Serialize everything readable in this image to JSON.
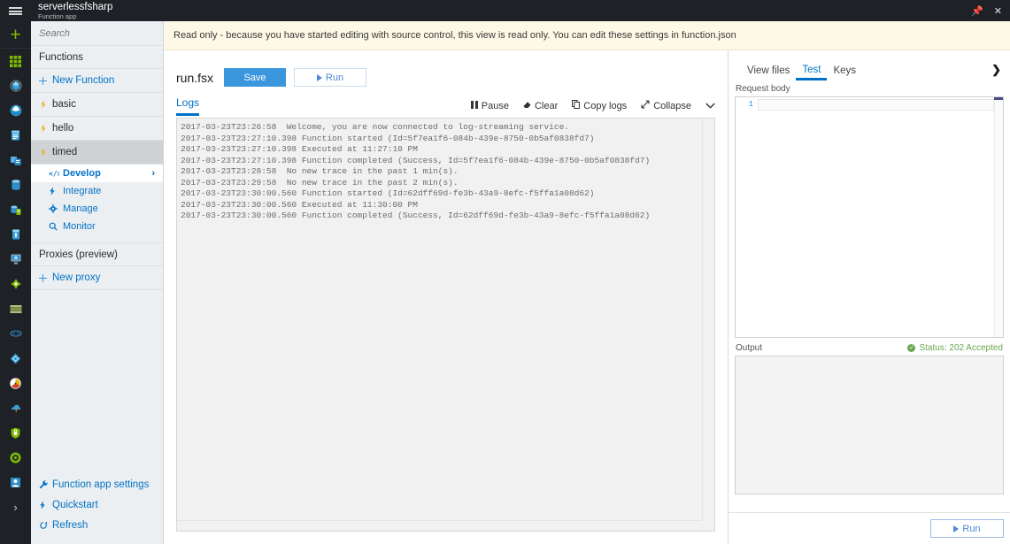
{
  "titlebar": {
    "app_name": "serverlessfsharp",
    "app_subtitle": "Function app",
    "pin_icon": "pin-icon",
    "close_icon": "close-icon"
  },
  "rail": {
    "hamburger": "hamburger-icon",
    "new_label": "+",
    "icons": [
      "dashboard-grid-icon",
      "all-resources-icon",
      "resource-groups-icon",
      "app-services-icon",
      "function-apps-icon",
      "sql-databases-icon",
      "azure-cosmos-db-icon",
      "virtual-machines-icon",
      "load-balancers-icon",
      "storage-accounts-icon",
      "virtual-networks-icon",
      "azure-active-directory-icon",
      "monitor-icon",
      "advisor-icon",
      "security-center-icon",
      "cost-management-icon",
      "help-support-icon"
    ],
    "more_chevron": "chevron-right-icon"
  },
  "banner": {
    "text": "Read only - because you have started editing with source control, this view is read only. You can edit these settings in function.json"
  },
  "sidebar": {
    "search": {
      "placeholder": "Search",
      "value": ""
    },
    "section_functions": "Functions",
    "new_function": "New Function",
    "functions": [
      {
        "label": "basic",
        "icon": "function-icon",
        "selected": false
      },
      {
        "label": "hello",
        "icon": "function-icon",
        "selected": false
      },
      {
        "label": "timed",
        "icon": "function-icon",
        "selected": true
      }
    ],
    "sub_items": [
      {
        "label": "Develop",
        "icon": "code-icon",
        "active": true
      },
      {
        "label": "Integrate",
        "icon": "bolt-icon",
        "active": false
      },
      {
        "label": "Manage",
        "icon": "gear-icon",
        "active": false
      },
      {
        "label": "Monitor",
        "icon": "search-icon",
        "active": false
      }
    ],
    "section_proxies": "Proxies (preview)",
    "new_proxy": "New proxy",
    "bottom_items": [
      {
        "label": "Function app settings",
        "icon": "wrench-icon"
      },
      {
        "label": "Quickstart",
        "icon": "bolt-icon"
      },
      {
        "label": "Refresh",
        "icon": "refresh-icon"
      }
    ]
  },
  "command_bar": {
    "file_name": "run.fsx",
    "save_label": "Save",
    "run_label": "Run"
  },
  "logs": {
    "tab_label": "Logs",
    "tools": [
      {
        "label": "Pause",
        "icon": "pause-icon"
      },
      {
        "label": "Clear",
        "icon": "eraser-icon"
      },
      {
        "label": "Copy logs",
        "icon": "copy-icon"
      },
      {
        "label": "Collapse",
        "icon": "collapse-icon"
      }
    ],
    "chevron": "chevron-down-icon",
    "lines": [
      "2017-03-23T23:26:58  Welcome, you are now connected to log-streaming service.",
      "2017-03-23T23:27:10.398 Function started (Id=5f7ea1f6-084b-439e-8750-0b5af0838fd7)",
      "2017-03-23T23:27:10.398 Executed at 11:27:10 PM",
      "2017-03-23T23:27:10.398 Function completed (Success, Id=5f7ea1f6-084b-439e-8750-0b5af0838fd7)",
      "2017-03-23T23:28:58  No new trace in the past 1 min(s).",
      "2017-03-23T23:29:58  No new trace in the past 2 min(s).",
      "2017-03-23T23:30:00.560 Function started (Id=62dff69d-fe3b-43a9-8efc-f5ffa1a08d62)",
      "2017-03-23T23:30:00.560 Executed at 11:30:00 PM",
      "2017-03-23T23:30:00.560 Function completed (Success, Id=62dff69d-fe3b-43a9-8efc-f5ffa1a08d62)"
    ]
  },
  "right_panel": {
    "tabs": [
      {
        "label": "View files",
        "active": false
      },
      {
        "label": "Test",
        "active": true
      },
      {
        "label": "Keys",
        "active": false
      }
    ],
    "expand_icon": "chevron-right-icon",
    "request_body_label": "Request body",
    "editor_line_number": "1",
    "editor_value": "",
    "output_label": "Output",
    "output_status": "Status: 202 Accepted",
    "output_status_color": "#6aa84f",
    "output_value": "",
    "run_label": "Run"
  }
}
